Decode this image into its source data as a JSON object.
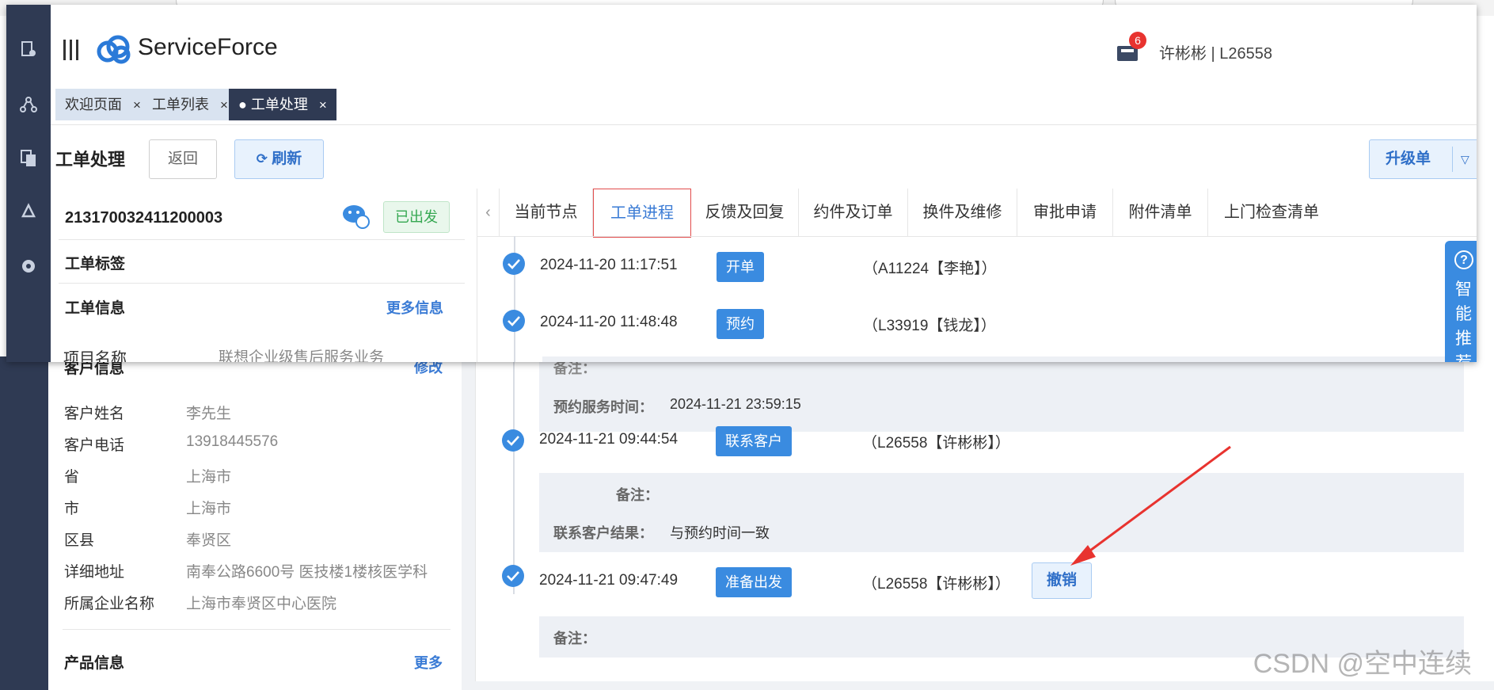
{
  "app": {
    "brand": "ServiceForce",
    "user": "许彬彬 | L26558",
    "notification_count": "6"
  },
  "nav_tabs": [
    {
      "label": "欢迎页面",
      "close": "×"
    },
    {
      "label": "工单列表",
      "close": "×"
    },
    {
      "label": "● 工单处理",
      "close": "×"
    }
  ],
  "header": {
    "title": "工单处理",
    "back": "返回",
    "refresh": "刷新",
    "upgrade": "升级单"
  },
  "order": {
    "number": "213170032411200003",
    "status": "已出发",
    "tags_title": "工单标签",
    "info_title": "工单信息",
    "more_info": "更多信息",
    "project_label": "项目名称",
    "project_value": "联想企业级售后服务业务"
  },
  "customer": {
    "title": "客户信息",
    "edit": "修改",
    "fields": [
      {
        "label": "客户姓名",
        "value": "李先生"
      },
      {
        "label": "客户电话",
        "value": "13918445576"
      },
      {
        "label": "省",
        "value": "上海市"
      },
      {
        "label": "市",
        "value": "上海市"
      },
      {
        "label": "区县",
        "value": "奉贤区"
      },
      {
        "label": "详细地址",
        "value": "南奉公路6600号 医技楼1楼核医学科"
      },
      {
        "label": "所属企业名称",
        "value": "上海市奉贤区中心医院"
      }
    ]
  },
  "product": {
    "title": "产品信息",
    "more": "更多"
  },
  "panel_tabs": [
    "当前节点",
    "工单进程",
    "反馈及回复",
    "约件及订单",
    "换件及维修",
    "审批申请",
    "附件清单",
    "上门检查清单"
  ],
  "progress": [
    {
      "time": "2024-11-20 11:17:51",
      "tag": "开单",
      "actor": "（A11224【李艳】）"
    },
    {
      "time": "2024-11-20 11:48:48",
      "tag": "预约",
      "actor": "（L33919【钱龙】）"
    },
    {
      "time": "2024-11-21 09:44:54",
      "tag": "联系客户",
      "actor": "（L26558【许彬彬】）"
    },
    {
      "time": "2024-11-21 09:47:49",
      "tag": "准备出发",
      "actor": "（L26558【许彬彬】）",
      "action": "撤销"
    }
  ],
  "notes": {
    "appt_partial": "备注：",
    "appt_time_label": "预约服务时间：",
    "appt_time_value": "2024-11-21 23:59:15",
    "contact_note_label": "备注：",
    "contact_result_label": "联系客户结果：",
    "contact_result_value": "与预约时间一致",
    "depart_note_label": "备注："
  },
  "smart_recommend": "智能推荐",
  "watermark": "CSDN @空中连续"
}
